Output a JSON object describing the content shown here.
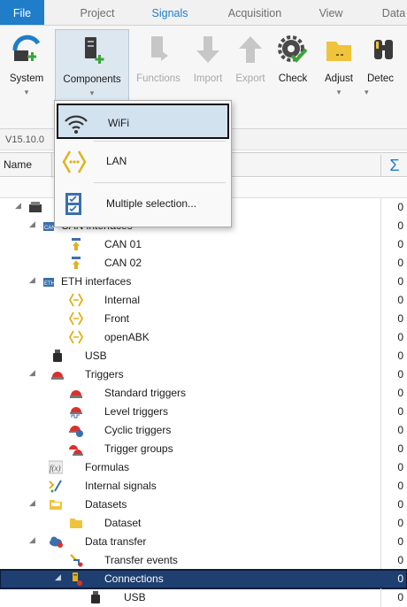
{
  "tabs": [
    "File",
    "Project",
    "Signals",
    "Acquisition",
    "View",
    "Data"
  ],
  "active_tab": "Signals",
  "ribbon": {
    "system": "System",
    "components": "Components",
    "functions": "Functions",
    "import": "Import",
    "export": "Export",
    "check": "Check",
    "adjust": "Adjust",
    "detect": "Detec",
    "dropdown_arrow": "▾"
  },
  "version": "V15.10.0",
  "header": {
    "name": "Name",
    "sum": "Σ"
  },
  "menu": {
    "wifi": "WiFi",
    "lan": "LAN",
    "multi": "Multiple selection..."
  },
  "tree": [
    {
      "label": "",
      "value": "0",
      "icon": "device-icon"
    },
    {
      "label": "CAN interfaces",
      "value": "0",
      "icon": "can-icon"
    },
    {
      "label": "CAN 01",
      "value": "0",
      "icon": "can-port-icon"
    },
    {
      "label": "CAN 02",
      "value": "0",
      "icon": "can-port-icon"
    },
    {
      "label": "ETH interfaces",
      "value": "0",
      "icon": "eth-icon"
    },
    {
      "label": "Internal",
      "value": "0",
      "icon": "lan-icon"
    },
    {
      "label": "Front",
      "value": "0",
      "icon": "lan-icon"
    },
    {
      "label": "openABK",
      "value": "0",
      "icon": "lan-icon"
    },
    {
      "label": "USB",
      "value": "0",
      "icon": "usb-icon"
    },
    {
      "label": "Triggers",
      "value": "0",
      "icon": "trigger-icon"
    },
    {
      "label": "Standard triggers",
      "value": "0",
      "icon": "trigger-icon"
    },
    {
      "label": "Level triggers",
      "value": "0",
      "icon": "level-trigger-icon"
    },
    {
      "label": "Cyclic triggers",
      "value": "0",
      "icon": "cyclic-trigger-icon"
    },
    {
      "label": "Trigger groups",
      "value": "0",
      "icon": "trigger-group-icon"
    },
    {
      "label": "Formulas",
      "value": "0",
      "icon": "formula-icon"
    },
    {
      "label": "Internal signals",
      "value": "0",
      "icon": "internal-signal-icon"
    },
    {
      "label": "Datasets",
      "value": "0",
      "icon": "folder-icon"
    },
    {
      "label": "Dataset",
      "value": "0",
      "icon": "folder-icon"
    },
    {
      "label": "Data transfer",
      "value": "0",
      "icon": "cloud-icon"
    },
    {
      "label": "Transfer events",
      "value": "0",
      "icon": "transfer-event-icon"
    },
    {
      "label": "Connections",
      "value": "0",
      "icon": "connection-icon"
    },
    {
      "label": "USB",
      "value": "0",
      "icon": "usb-icon"
    }
  ],
  "colors": {
    "accent": "#1f7dc9",
    "selected_row": "#1e3f70",
    "lan": "#e0b21c",
    "trigger": "#d9312b"
  }
}
